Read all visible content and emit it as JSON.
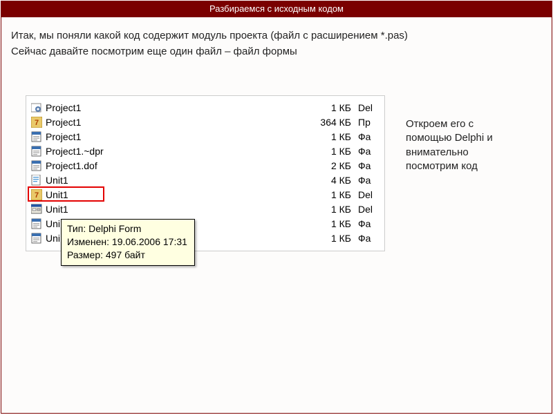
{
  "header_title": "Разбираемся с исходным кодом",
  "paragraph1": " Итак, мы поняли какой код содержит модуль проекта (файл с расширением *.pas)",
  "paragraph2": "Сейчас давайте посмотрим еще один файл – файл формы",
  "side_text": " Откроем его с помощью Delphi и внимательно посмотрим код",
  "tooltip": {
    "line1": "Тип: Delphi Form",
    "line2": "Изменен: 19.06.2006 17:31",
    "line3": "Размер: 497 байт"
  },
  "files": [
    {
      "icon": "gear",
      "name": "Project1",
      "size": "1 КБ",
      "type": "Del"
    },
    {
      "icon": "delphi7",
      "name": "Project1",
      "size": "364 КБ",
      "type": "Пр"
    },
    {
      "icon": "winfile",
      "name": "Project1",
      "size": "1 КБ",
      "type": "Фа"
    },
    {
      "icon": "winfile",
      "name": "Project1.~dpr",
      "size": "1 КБ",
      "type": "Фа"
    },
    {
      "icon": "winfile",
      "name": "Project1.dof",
      "size": "2 КБ",
      "type": "Фа"
    },
    {
      "icon": "pasfile",
      "name": "Unit1",
      "size": "4 КБ",
      "type": "Фа"
    },
    {
      "icon": "delphi7",
      "name": "Unit1",
      "size": "1 КБ",
      "type": "Del"
    },
    {
      "icon": "formwin",
      "name": "Unit1",
      "size": "1 КБ",
      "type": "Del"
    },
    {
      "icon": "winfile",
      "name": "Uni",
      "size": "1 КБ",
      "type": "Фа"
    },
    {
      "icon": "winfile",
      "name": "Uni",
      "size": "1 КБ",
      "type": "Фа"
    }
  ]
}
